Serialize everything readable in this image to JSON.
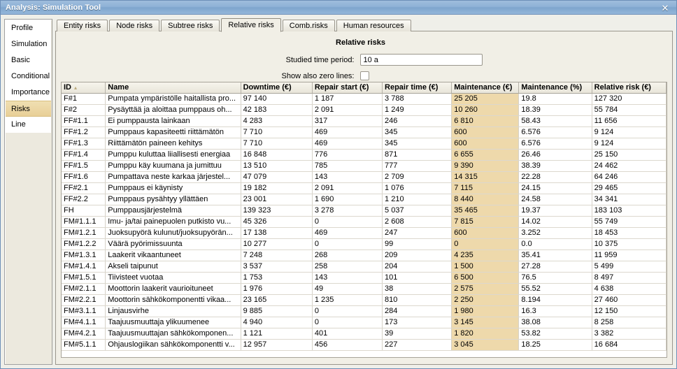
{
  "window": {
    "title": "Analysis: Simulation Tool",
    "close_label": "✕",
    "titlebar_color": "#8fb2d6",
    "border_color": "#6d8fb8"
  },
  "sidebar": {
    "items": [
      {
        "label": "Profile",
        "selected": false
      },
      {
        "label": "Simulation",
        "selected": false
      },
      {
        "label": "Basic",
        "selected": false
      },
      {
        "label": "Conditional",
        "selected": false
      },
      {
        "label": "Importance",
        "selected": false
      },
      {
        "label": "Risks",
        "selected": true
      },
      {
        "label": "Line",
        "selected": false
      }
    ],
    "selected_color": "#ecd9a5"
  },
  "tabs": [
    {
      "label": "Entity risks",
      "active": false
    },
    {
      "label": "Node risks",
      "active": false
    },
    {
      "label": "Subtree risks",
      "active": false
    },
    {
      "label": "Relative risks",
      "active": true
    },
    {
      "label": "Comb.risks",
      "active": false
    },
    {
      "label": "Human resources",
      "active": false
    }
  ],
  "panel": {
    "title": "Relative risks",
    "fields": {
      "time_period_label": "Studied time period:",
      "time_period_value": "10 a",
      "time_period_placeholder": "",
      "zero_lines_label": "Show also zero lines:",
      "zero_lines_checked": false
    }
  },
  "table": {
    "sort_column": "ID",
    "sort_arrow": "▴",
    "highlight_color": "#eed9ab",
    "columns": [
      "ID",
      "Name",
      "Downtime (€)",
      "Repair start (€)",
      "Repair time (€)",
      "Maintenance (€)",
      "Maintenance (%)",
      "Relative risk (€)"
    ],
    "rows": [
      {
        "id": "F#1",
        "name": "Pumpata ympäristölle haitallista pro...",
        "downtime": "97 140",
        "repair_start": "1 187",
        "repair_time": "3 788",
        "maint_eur": "25 205",
        "maint_pct": "19.8",
        "rel_risk": "127 320"
      },
      {
        "id": "F#2",
        "name": "Pysäyttää ja aloittaa pumppaus oh...",
        "downtime": "42 183",
        "repair_start": "2 091",
        "repair_time": "1 249",
        "maint_eur": "10 260",
        "maint_pct": "18.39",
        "rel_risk": "55 784"
      },
      {
        "id": "FF#1.1",
        "name": "Ei pumppausta lainkaan",
        "downtime": "4 283",
        "repair_start": "317",
        "repair_time": "246",
        "maint_eur": "6 810",
        "maint_pct": "58.43",
        "rel_risk": "11 656"
      },
      {
        "id": "FF#1.2",
        "name": "Pumppaus kapasiteetti riittämätön",
        "downtime": "7 710",
        "repair_start": "469",
        "repair_time": "345",
        "maint_eur": "600",
        "maint_pct": "6.576",
        "rel_risk": "9 124"
      },
      {
        "id": "FF#1.3",
        "name": "Riittämätön paineen kehitys",
        "downtime": "7 710",
        "repair_start": "469",
        "repair_time": "345",
        "maint_eur": "600",
        "maint_pct": "6.576",
        "rel_risk": "9 124"
      },
      {
        "id": "FF#1.4",
        "name": "Pumppu kuluttaa liiallisesti energiaa",
        "downtime": "16 848",
        "repair_start": "776",
        "repair_time": "871",
        "maint_eur": "6 655",
        "maint_pct": "26.46",
        "rel_risk": "25 150"
      },
      {
        "id": "FF#1.5",
        "name": "Pumppu käy kuumana ja jumittuu",
        "downtime": "13 510",
        "repair_start": "785",
        "repair_time": "777",
        "maint_eur": "9 390",
        "maint_pct": "38.39",
        "rel_risk": "24 462"
      },
      {
        "id": "FF#1.6",
        "name": "Pumpattava neste karkaa järjestel...",
        "downtime": "47 079",
        "repair_start": "143",
        "repair_time": "2 709",
        "maint_eur": "14 315",
        "maint_pct": "22.28",
        "rel_risk": "64 246"
      },
      {
        "id": "FF#2.1",
        "name": "Pumppaus ei käynisty",
        "downtime": "19 182",
        "repair_start": "2 091",
        "repair_time": "1 076",
        "maint_eur": "7 115",
        "maint_pct": "24.15",
        "rel_risk": "29 465"
      },
      {
        "id": "FF#2.2",
        "name": "Pumppaus pysähtyy yllättäen",
        "downtime": "23 001",
        "repair_start": "1 690",
        "repair_time": "1 210",
        "maint_eur": "8 440",
        "maint_pct": "24.58",
        "rel_risk": "34 341"
      },
      {
        "id": "FH",
        "name": "Pumppausjärjestelmä",
        "downtime": "139 323",
        "repair_start": "3 278",
        "repair_time": "5 037",
        "maint_eur": "35 465",
        "maint_pct": "19.37",
        "rel_risk": "183 103"
      },
      {
        "id": "FM#1.1.1",
        "name": "Imu- ja/tai painepuolen putkisto vu...",
        "downtime": "45 326",
        "repair_start": "0",
        "repair_time": "2 608",
        "maint_eur": "7 815",
        "maint_pct": "14.02",
        "rel_risk": "55 749"
      },
      {
        "id": "FM#1.2.1",
        "name": "Juoksupyörä kulunut/juoksupyörän...",
        "downtime": "17 138",
        "repair_start": "469",
        "repair_time": "247",
        "maint_eur": "600",
        "maint_pct": "3.252",
        "rel_risk": "18 453"
      },
      {
        "id": "FM#1.2.2",
        "name": "Väärä pyörimissuunta",
        "downtime": "10 277",
        "repair_start": "0",
        "repair_time": "99",
        "maint_eur": "0",
        "maint_pct": "0.0",
        "rel_risk": "10 375"
      },
      {
        "id": "FM#1.3.1",
        "name": "Laakerit vikaantuneet",
        "downtime": "7 248",
        "repair_start": "268",
        "repair_time": "209",
        "maint_eur": "4 235",
        "maint_pct": "35.41",
        "rel_risk": "11 959"
      },
      {
        "id": "FM#1.4.1",
        "name": "Akseli taipunut",
        "downtime": "3 537",
        "repair_start": "258",
        "repair_time": "204",
        "maint_eur": "1 500",
        "maint_pct": "27.28",
        "rel_risk": "5 499"
      },
      {
        "id": "FM#1.5.1",
        "name": "Tiivisteet vuotaa",
        "downtime": "1 753",
        "repair_start": "143",
        "repair_time": "101",
        "maint_eur": "6 500",
        "maint_pct": "76.5",
        "rel_risk": "8 497"
      },
      {
        "id": "FM#2.1.1",
        "name": "Moottorin laakerit vaurioituneet",
        "downtime": "1 976",
        "repair_start": "49",
        "repair_time": "38",
        "maint_eur": "2 575",
        "maint_pct": "55.52",
        "rel_risk": "4 638"
      },
      {
        "id": "FM#2.2.1",
        "name": "Moottorin sähkökomponentti vikaa...",
        "downtime": "23 165",
        "repair_start": "1 235",
        "repair_time": "810",
        "maint_eur": "2 250",
        "maint_pct": "8.194",
        "rel_risk": "27 460"
      },
      {
        "id": "FM#3.1.1",
        "name": "Linjausvirhe",
        "downtime": "9 885",
        "repair_start": "0",
        "repair_time": "284",
        "maint_eur": "1 980",
        "maint_pct": "16.3",
        "rel_risk": "12 150"
      },
      {
        "id": "FM#4.1.1",
        "name": "Taajuusmuuttaja ylikuumenee",
        "downtime": "4 940",
        "repair_start": "0",
        "repair_time": "173",
        "maint_eur": "3 145",
        "maint_pct": "38.08",
        "rel_risk": "8 258"
      },
      {
        "id": "FM#4.2.1",
        "name": "Taajuusmuuttajan sähkökomponen...",
        "downtime": "1 121",
        "repair_start": "401",
        "repair_time": "39",
        "maint_eur": "1 820",
        "maint_pct": "53.82",
        "rel_risk": "3 382"
      },
      {
        "id": "FM#5.1.1",
        "name": "Ohjauslogiikan sähkökomponentti v...",
        "downtime": "12 957",
        "repair_start": "456",
        "repair_time": "227",
        "maint_eur": "3 045",
        "maint_pct": "18.25",
        "rel_risk": "16 684"
      }
    ]
  }
}
